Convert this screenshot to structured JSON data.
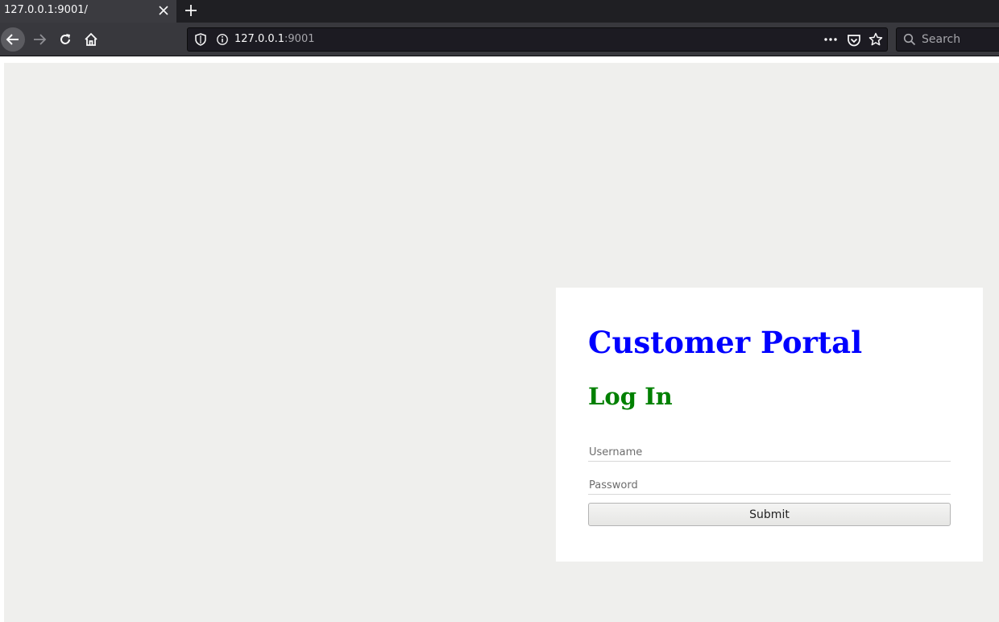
{
  "browser": {
    "tab": {
      "title": "127.0.0.1:9001/"
    },
    "url": {
      "host": "127.0.0.1",
      "port": ":9001"
    },
    "search": {
      "placeholder": "Search"
    },
    "icons": {
      "back": "arrow-left-icon",
      "forward": "arrow-right-icon",
      "reload": "reload-icon",
      "home": "home-icon",
      "shield": "shield-icon",
      "info": "info-icon",
      "more": "ellipsis-icon",
      "pocket": "pocket-icon",
      "bookmark": "star-icon",
      "search": "search-icon",
      "close_tab": "close-icon",
      "new_tab": "plus-icon"
    }
  },
  "page": {
    "title": "Customer Portal",
    "heading": "Log In",
    "form": {
      "username_placeholder": "Username",
      "password_placeholder": "Password",
      "submit_label": "Submit"
    },
    "colors": {
      "title": "#0000ff",
      "heading": "#008000",
      "background": "#efefed",
      "card": "#ffffff"
    }
  }
}
